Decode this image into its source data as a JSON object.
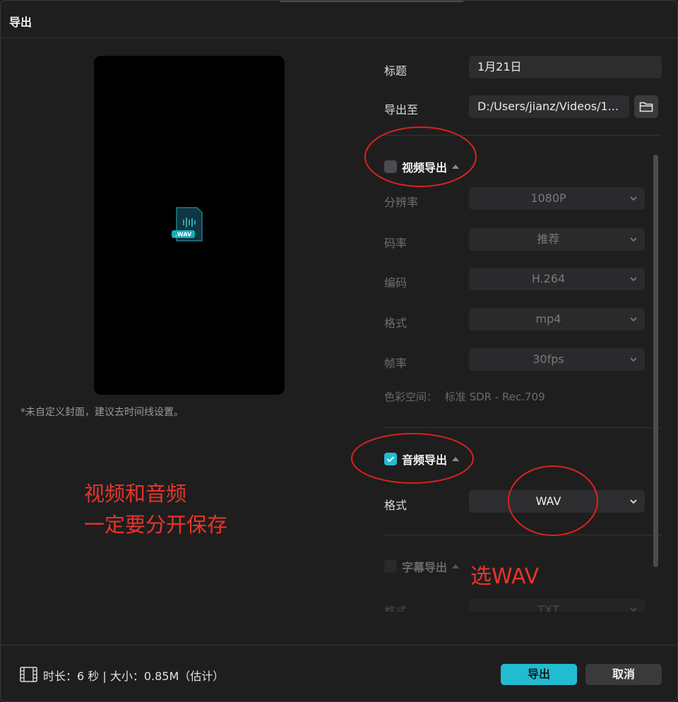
{
  "dialog": {
    "title": "导出"
  },
  "preview": {
    "badge": ".WAV",
    "hint": "*未自定义封面，建议去时间线设置。"
  },
  "form": {
    "title_label": "标题",
    "title_value": "1月21日",
    "path_label": "导出至",
    "path_value": "D:/Users/jianz/Videos/1..."
  },
  "video": {
    "section_label": "视频导出",
    "checked": false,
    "rows": [
      {
        "label": "分辨率",
        "value": "1080P"
      },
      {
        "label": "码率",
        "value": "推荐"
      },
      {
        "label": "编码",
        "value": "H.264"
      },
      {
        "label": "格式",
        "value": "mp4"
      },
      {
        "label": "帧率",
        "value": "30fps"
      }
    ],
    "colorspace_label": "色彩空间：",
    "colorspace_value": "标准 SDR - Rec.709"
  },
  "audio": {
    "section_label": "音频导出",
    "checked": true,
    "format_label": "格式",
    "format_value": "WAV"
  },
  "subtitle": {
    "section_label": "字幕导出",
    "checked": false,
    "format_label": "格式",
    "format_value": "TXT"
  },
  "annotations": {
    "left_line1": "视频和音频",
    "left_line2": "一定要分开保存",
    "wav_note": "选WAV"
  },
  "footer": {
    "info": "时长：6 秒 | 大小：0.85M（估计）",
    "export_label": "导出",
    "cancel_label": "取消"
  },
  "colors": {
    "accent": "#22bcd0",
    "annotation_red": "#e8342b"
  }
}
